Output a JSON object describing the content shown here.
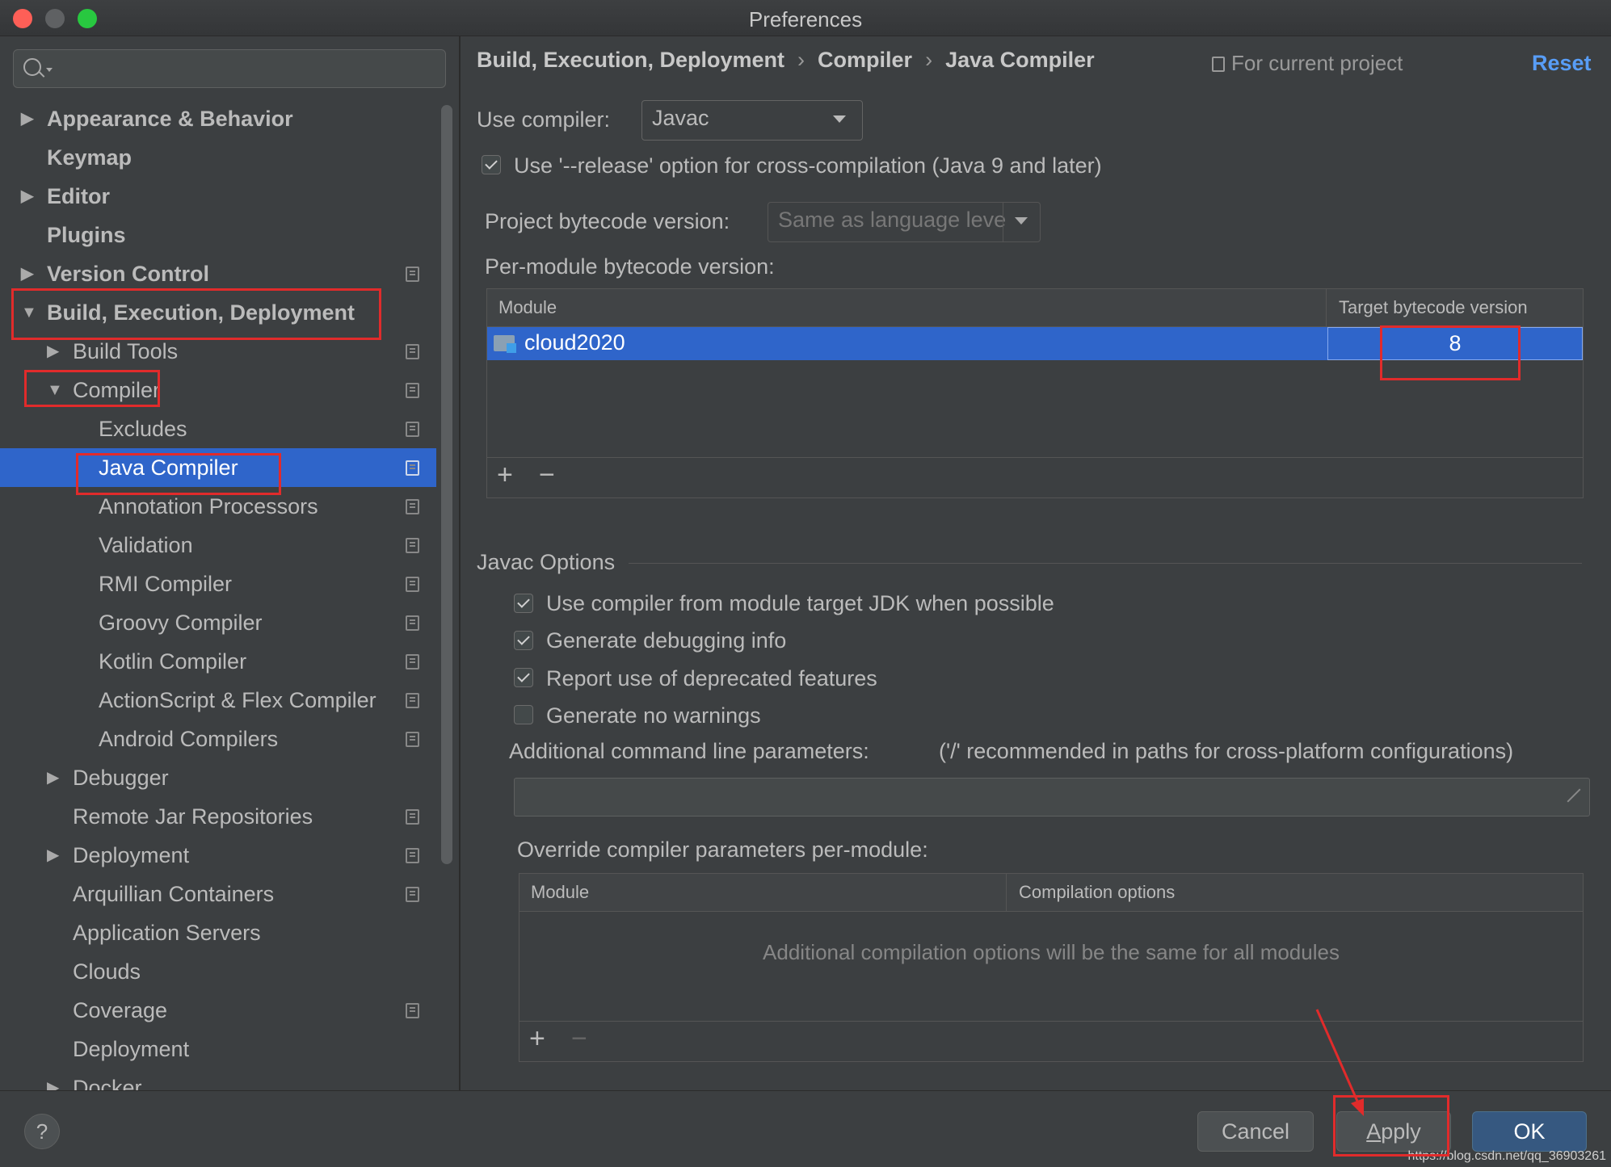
{
  "window": {
    "title": "Preferences"
  },
  "sidebar": {
    "search": {
      "placeholder": ""
    },
    "items": [
      {
        "label": "Appearance & Behavior",
        "expanded": false,
        "has_children": true
      },
      {
        "label": "Keymap"
      },
      {
        "label": "Editor",
        "expanded": false,
        "has_children": true
      },
      {
        "label": "Plugins"
      },
      {
        "label": "Version Control",
        "expanded": false,
        "has_children": true
      },
      {
        "label": "Build, Execution, Deployment",
        "expanded": true,
        "has_children": true
      },
      {
        "label": "Build Tools",
        "expanded": false,
        "has_children": true
      },
      {
        "label": "Compiler",
        "expanded": true,
        "has_children": true
      },
      {
        "label": "Excludes"
      },
      {
        "label": "Java Compiler",
        "selected": true
      },
      {
        "label": "Annotation Processors"
      },
      {
        "label": "Validation"
      },
      {
        "label": "RMI Compiler"
      },
      {
        "label": "Groovy Compiler"
      },
      {
        "label": "Kotlin Compiler"
      },
      {
        "label": "ActionScript & Flex Compiler"
      },
      {
        "label": "Android Compilers"
      },
      {
        "label": "Debugger",
        "expanded": false,
        "has_children": true
      },
      {
        "label": "Remote Jar Repositories"
      },
      {
        "label": "Deployment",
        "expanded": false,
        "has_children": true
      },
      {
        "label": "Arquillian Containers"
      },
      {
        "label": "Application Servers"
      },
      {
        "label": "Clouds"
      },
      {
        "label": "Coverage"
      },
      {
        "label": "Deployment"
      },
      {
        "label": "Docker",
        "expanded": false,
        "has_children": true
      }
    ]
  },
  "breadcrumb": [
    "Build, Execution, Deployment",
    "Compiler",
    "Java Compiler"
  ],
  "breadcrumb_sep": "›",
  "header": {
    "scope": "For current project",
    "reset_label": "Reset"
  },
  "compiler": {
    "label": "Use compiler:",
    "value": "Javac"
  },
  "release_option": {
    "label": "Use '--release' option for cross-compilation (Java 9 and later)",
    "checked": true
  },
  "project_bytecode": {
    "label": "Project bytecode version:",
    "value": "Same as language leve"
  },
  "per_module": {
    "label": "Per-module bytecode version:",
    "columns": [
      "Module",
      "Target bytecode version"
    ],
    "rows": [
      {
        "module": "cloud2020",
        "version": "8"
      }
    ],
    "add": "+",
    "remove": "−"
  },
  "javac": {
    "title": "Javac Options",
    "options": [
      {
        "label": "Use compiler from module target JDK when possible",
        "checked": true
      },
      {
        "label": "Generate debugging info",
        "checked": true
      },
      {
        "label": "Report use of deprecated features",
        "checked": true
      },
      {
        "label": "Generate no warnings",
        "checked": false
      }
    ],
    "additional_label": "Additional command line parameters:",
    "additional_hint": "('/' recommended in paths for cross-platform configurations)",
    "additional_value": ""
  },
  "override": {
    "label": "Override compiler parameters per-module:",
    "columns": [
      "Module",
      "Compilation options"
    ],
    "empty_text": "Additional compilation options will be the same for all modules",
    "add": "+",
    "remove": "−"
  },
  "footer": {
    "help": "?",
    "cancel": "Cancel",
    "apply_mnemonic": "A",
    "apply_rest": "pply",
    "ok": "OK",
    "watermark": "https://blog.csdn.net/qq_36903261"
  },
  "colors": {
    "selection": "#2f65ca",
    "link": "#589df6",
    "annotation": "#e12b2b",
    "background": "#3c3f41"
  }
}
